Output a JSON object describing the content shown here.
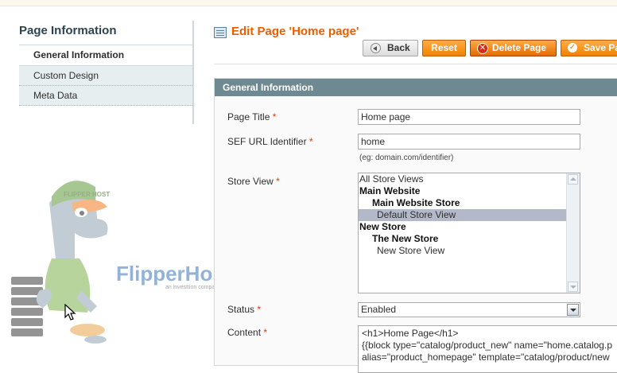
{
  "sidebar": {
    "title": "Page Information",
    "tabs": [
      {
        "label": "General Information"
      },
      {
        "label": "Custom Design"
      },
      {
        "label": "Meta Data"
      }
    ]
  },
  "header": {
    "title": "Edit Page 'Home page'",
    "buttons": {
      "back": "Back",
      "reset": "Reset",
      "delete": "Delete Page",
      "save": "Save Page"
    }
  },
  "section": {
    "title": "General Information",
    "fields": {
      "page_title": {
        "label": "Page Title",
        "value": "Home page"
      },
      "identifier": {
        "label": "SEF URL Identifier",
        "value": "home",
        "note": "(eg: domain.com/identifier)"
      },
      "store_view": {
        "label": "Store View",
        "options": [
          {
            "text": "All Store Views"
          },
          {
            "text": "Main Website"
          },
          {
            "text": "Main Website Store"
          },
          {
            "text": "Default Store View"
          },
          {
            "text": "New Store"
          },
          {
            "text": "The New Store"
          },
          {
            "text": "New Store View"
          }
        ]
      },
      "status": {
        "label": "Status",
        "value": "Enabled"
      },
      "content": {
        "label": "Content",
        "line1": "<h1>Home Page</h1>",
        "line2": "{{block type=\"catalog/product_new\" name=\"home.catalog.p",
        "line3": "alias=\"product_homepage\" template=\"catalog/product/new"
      }
    },
    "required_mark": "*"
  },
  "watermark": {
    "brand": "FlipperHost",
    "tagline": "an investtion company",
    "cap_text": "FLIPPER HOST"
  }
}
